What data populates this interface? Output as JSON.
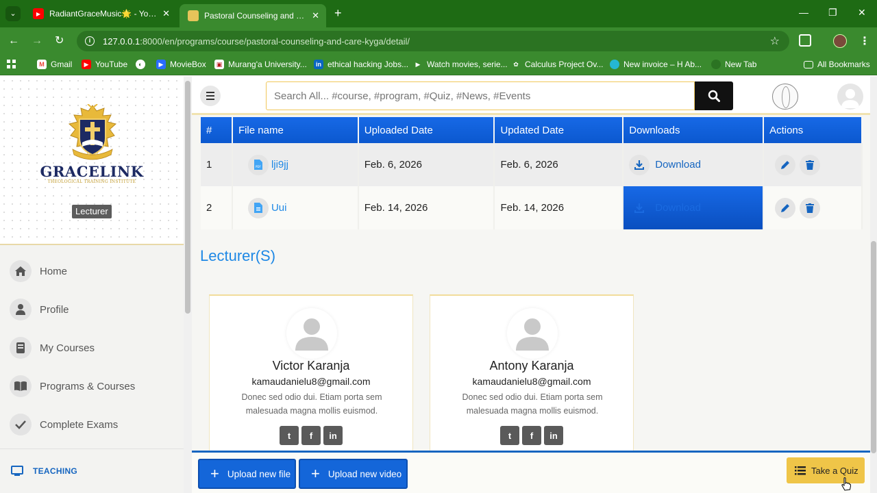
{
  "browser": {
    "tabs": [
      {
        "title": "RadiantGraceMusic🌟 - YouTube"
      },
      {
        "title": "Pastoral Counseling and Care | GraceLink"
      }
    ],
    "url_host": "127.0.0.1",
    "url_path": ":8000/en/programs/course/pastoral-counseling-and-care-kyga/detail/",
    "bookmarks": [
      {
        "label": "Gmail",
        "icon": "gmail-icon",
        "color": "#ea4335"
      },
      {
        "label": "YouTube",
        "icon": "youtube-icon",
        "color": "#ff0000"
      },
      {
        "label": "MovieBox",
        "icon": "moviebox-icon",
        "color": "#2a6cff"
      },
      {
        "label": "Murang'a University...",
        "icon": "university-icon",
        "color": "#b71c1c"
      },
      {
        "label": "ethical hacking Jobs...",
        "icon": "linkedin-icon",
        "color": "#0a66c2"
      },
      {
        "label": "Watch movies, serie...",
        "icon": "play-icon",
        "color": "#2e7d32"
      },
      {
        "label": "Calculus Project Ov...",
        "icon": "openai-icon",
        "color": "#555555"
      },
      {
        "label": "New invoice – H Ab...",
        "icon": "invoice-icon",
        "color": "#25b7d3"
      },
      {
        "label": "New Tab",
        "icon": "newtab-icon",
        "color": "#2b7322"
      }
    ],
    "all_bookmarks": "All Bookmarks"
  },
  "sidebar": {
    "brand_name": "GRACELINK",
    "brand_sub": "THEOLOGICAL TRAINING INSTITUTE",
    "role": "Lecturer",
    "items": [
      {
        "label": "Home",
        "icon": "home-icon"
      },
      {
        "label": "Profile",
        "icon": "user-icon"
      },
      {
        "label": "My Courses",
        "icon": "book-icon"
      },
      {
        "label": "Programs & Courses",
        "icon": "open-book-icon"
      },
      {
        "label": "Complete Exams",
        "icon": "check-icon"
      }
    ],
    "section": "TEACHING"
  },
  "topbar": {
    "search_placeholder": "Search All... #course, #program, #Quiz, #News, #Events"
  },
  "files": {
    "headers": [
      "#",
      "File name",
      "Uploaded Date",
      "Updated Date",
      "Downloads",
      "Actions"
    ],
    "rows": [
      {
        "num": "1",
        "name": "lji9jj",
        "uploaded": "Feb. 6, 2026",
        "updated": "Feb. 6, 2026",
        "download": "Download"
      },
      {
        "num": "2",
        "name": "Uui",
        "uploaded": "Feb. 14, 2026",
        "updated": "Feb. 14, 2026",
        "download": "Download"
      }
    ]
  },
  "lecturers": {
    "title": "Lecturer(S)",
    "cards": [
      {
        "name": "Victor Karanja",
        "email": "kamaudanielu8@gmail.com",
        "desc": "Donec sed odio dui. Etiam porta sem malesuada magna mollis euismod."
      },
      {
        "name": "Antony Karanja",
        "email": "kamaudanielu8@gmail.com",
        "desc": "Donec sed odio dui. Etiam porta sem malesuada magna mollis euismod."
      }
    ]
  },
  "bottom": {
    "upload_file": "Upload new file",
    "upload_video": "Upload new video",
    "quiz": "Take a Quiz"
  },
  "colors": {
    "primary": "#1466d9",
    "accent": "#efc548",
    "chrome": "#3a8a2e"
  }
}
